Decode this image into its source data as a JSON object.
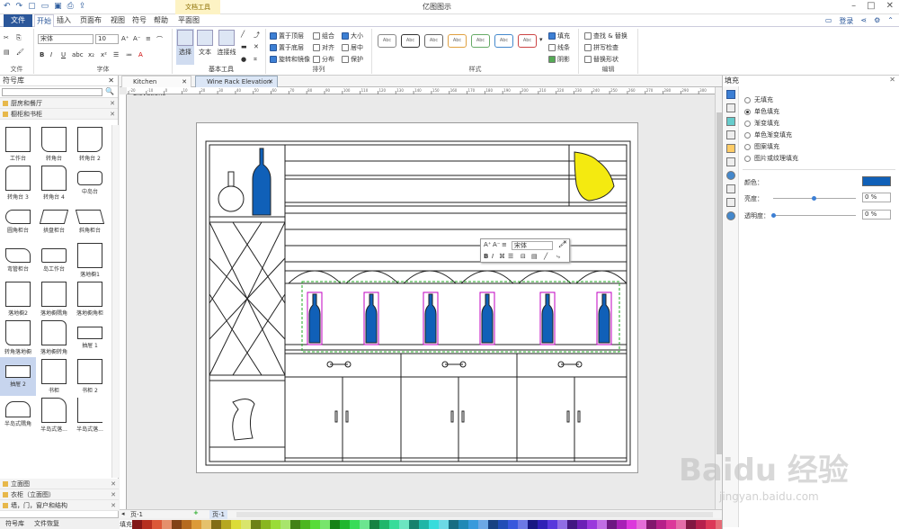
{
  "title_bar": {
    "app_title": "亿图图示",
    "context_tab": "文档工具"
  },
  "menu": {
    "file": "文件",
    "items": [
      "开始",
      "插入",
      "页面布局",
      "视图",
      "符号",
      "帮助",
      "平面图"
    ],
    "login": "登录"
  },
  "ribbon": {
    "groups": {
      "file": "文件",
      "font": "字体",
      "basic_tools": "基本工具",
      "arrange": "排列",
      "style": "样式",
      "edit": "编辑"
    },
    "font_name": "宋体",
    "font_size": "10",
    "tools": {
      "select": "选择",
      "text": "文本",
      "connector": "连接线"
    },
    "arrange": {
      "bring_front": "置于顶层",
      "send_back": "置于底层",
      "rotate_mirror": "旋转和镜像",
      "group": "组合",
      "align": "对齐",
      "distribute": "分布",
      "size": "大小",
      "center": "居中",
      "protect": "保护"
    },
    "style_items": [
      "Abc",
      "Abc",
      "Abc",
      "Abc",
      "Abc",
      "Abc",
      "Abc"
    ],
    "style_right": {
      "fill": "填充",
      "line": "线条",
      "shadow": "阴影"
    },
    "edit": {
      "find_replace": "查找 & 替换",
      "spell_check": "拼写检查",
      "replace_shape": "替换形状"
    }
  },
  "left_panel": {
    "title": "符号库",
    "categories_top": [
      "厨房和餐厅",
      "橱柜和书柜"
    ],
    "shapes": [
      "工作台",
      "转角台",
      "转角台 2",
      "转角台 3",
      "转角台 4",
      "中岛台",
      "圆角柜台",
      "拱盘柜台",
      "斜角柜台",
      "弯管柜台",
      "岛工作台",
      "落地橱1",
      "落地橱2",
      "落地橱隅角",
      "落地橱角柜",
      "转角落地橱",
      "落地橱转角",
      "抽屉 1",
      "抽屉 2",
      "书柜",
      "书柜 2",
      "半岛式隅角",
      "半岛式落...",
      "半岛式落..."
    ],
    "selected_shape": "抽屉 2",
    "categories_bottom": [
      "立面图",
      "衣柜（立面图）",
      "墙，门，窗户和结构"
    ],
    "tabs": [
      "符号库",
      "文件恢复"
    ]
  },
  "document": {
    "tabs": [
      "Kitchen Elevations",
      "Wine Rack Elevation"
    ],
    "active_tab": "Wine Rack Elevation",
    "ruler_ticks": [
      "-20",
      "-10",
      "0",
      "10",
      "20",
      "30",
      "40",
      "50",
      "60",
      "70",
      "80",
      "90",
      "100",
      "110",
      "120",
      "130",
      "140",
      "150",
      "160",
      "170",
      "180",
      "190",
      "200",
      "210",
      "220",
      "230",
      "240",
      "250",
      "260",
      "270",
      "280",
      "290",
      "300"
    ],
    "floating_font": "宋体",
    "page_label": "页-1",
    "page_tab": "页-1"
  },
  "right_panel": {
    "title": "填充",
    "options": [
      "无填充",
      "单色填充",
      "渐变填充",
      "单色渐变填充",
      "图案填充",
      "图片或纹理填充"
    ],
    "selected_option": "单色填充",
    "color_label": "颜色：",
    "brightness_label": "亮度：",
    "brightness_value": "0 %",
    "transparency_label": "透明度：",
    "transparency_value": "0 %",
    "fill_color": "#1060b8"
  },
  "status": {
    "fill_label": "填充"
  },
  "watermark": {
    "logo": "Baidu 经验",
    "url": "jingyan.baidu.com"
  }
}
